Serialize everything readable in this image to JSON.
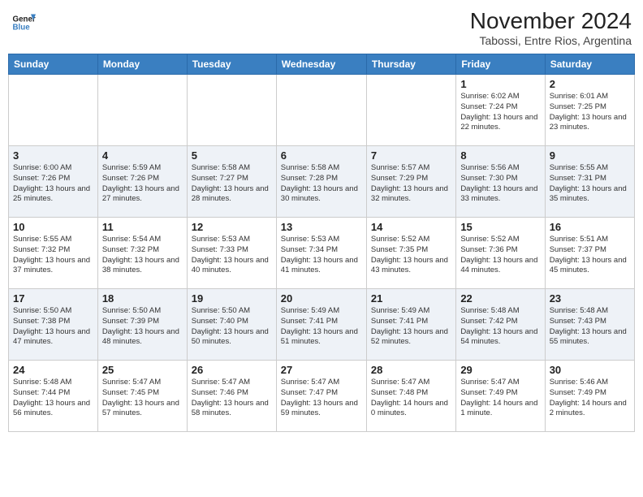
{
  "header": {
    "logo_line1": "General",
    "logo_line2": "Blue",
    "title": "November 2024",
    "subtitle": "Tabossi, Entre Rios, Argentina"
  },
  "days_of_week": [
    "Sunday",
    "Monday",
    "Tuesday",
    "Wednesday",
    "Thursday",
    "Friday",
    "Saturday"
  ],
  "weeks": [
    [
      {
        "day": "",
        "info": ""
      },
      {
        "day": "",
        "info": ""
      },
      {
        "day": "",
        "info": ""
      },
      {
        "day": "",
        "info": ""
      },
      {
        "day": "",
        "info": ""
      },
      {
        "day": "1",
        "info": "Sunrise: 6:02 AM\nSunset: 7:24 PM\nDaylight: 13 hours\nand 22 minutes."
      },
      {
        "day": "2",
        "info": "Sunrise: 6:01 AM\nSunset: 7:25 PM\nDaylight: 13 hours\nand 23 minutes."
      }
    ],
    [
      {
        "day": "3",
        "info": "Sunrise: 6:00 AM\nSunset: 7:26 PM\nDaylight: 13 hours\nand 25 minutes."
      },
      {
        "day": "4",
        "info": "Sunrise: 5:59 AM\nSunset: 7:26 PM\nDaylight: 13 hours\nand 27 minutes."
      },
      {
        "day": "5",
        "info": "Sunrise: 5:58 AM\nSunset: 7:27 PM\nDaylight: 13 hours\nand 28 minutes."
      },
      {
        "day": "6",
        "info": "Sunrise: 5:58 AM\nSunset: 7:28 PM\nDaylight: 13 hours\nand 30 minutes."
      },
      {
        "day": "7",
        "info": "Sunrise: 5:57 AM\nSunset: 7:29 PM\nDaylight: 13 hours\nand 32 minutes."
      },
      {
        "day": "8",
        "info": "Sunrise: 5:56 AM\nSunset: 7:30 PM\nDaylight: 13 hours\nand 33 minutes."
      },
      {
        "day": "9",
        "info": "Sunrise: 5:55 AM\nSunset: 7:31 PM\nDaylight: 13 hours\nand 35 minutes."
      }
    ],
    [
      {
        "day": "10",
        "info": "Sunrise: 5:55 AM\nSunset: 7:32 PM\nDaylight: 13 hours\nand 37 minutes."
      },
      {
        "day": "11",
        "info": "Sunrise: 5:54 AM\nSunset: 7:32 PM\nDaylight: 13 hours\nand 38 minutes."
      },
      {
        "day": "12",
        "info": "Sunrise: 5:53 AM\nSunset: 7:33 PM\nDaylight: 13 hours\nand 40 minutes."
      },
      {
        "day": "13",
        "info": "Sunrise: 5:53 AM\nSunset: 7:34 PM\nDaylight: 13 hours\nand 41 minutes."
      },
      {
        "day": "14",
        "info": "Sunrise: 5:52 AM\nSunset: 7:35 PM\nDaylight: 13 hours\nand 43 minutes."
      },
      {
        "day": "15",
        "info": "Sunrise: 5:52 AM\nSunset: 7:36 PM\nDaylight: 13 hours\nand 44 minutes."
      },
      {
        "day": "16",
        "info": "Sunrise: 5:51 AM\nSunset: 7:37 PM\nDaylight: 13 hours\nand 45 minutes."
      }
    ],
    [
      {
        "day": "17",
        "info": "Sunrise: 5:50 AM\nSunset: 7:38 PM\nDaylight: 13 hours\nand 47 minutes."
      },
      {
        "day": "18",
        "info": "Sunrise: 5:50 AM\nSunset: 7:39 PM\nDaylight: 13 hours\nand 48 minutes."
      },
      {
        "day": "19",
        "info": "Sunrise: 5:50 AM\nSunset: 7:40 PM\nDaylight: 13 hours\nand 50 minutes."
      },
      {
        "day": "20",
        "info": "Sunrise: 5:49 AM\nSunset: 7:41 PM\nDaylight: 13 hours\nand 51 minutes."
      },
      {
        "day": "21",
        "info": "Sunrise: 5:49 AM\nSunset: 7:41 PM\nDaylight: 13 hours\nand 52 minutes."
      },
      {
        "day": "22",
        "info": "Sunrise: 5:48 AM\nSunset: 7:42 PM\nDaylight: 13 hours\nand 54 minutes."
      },
      {
        "day": "23",
        "info": "Sunrise: 5:48 AM\nSunset: 7:43 PM\nDaylight: 13 hours\nand 55 minutes."
      }
    ],
    [
      {
        "day": "24",
        "info": "Sunrise: 5:48 AM\nSunset: 7:44 PM\nDaylight: 13 hours\nand 56 minutes."
      },
      {
        "day": "25",
        "info": "Sunrise: 5:47 AM\nSunset: 7:45 PM\nDaylight: 13 hours\nand 57 minutes."
      },
      {
        "day": "26",
        "info": "Sunrise: 5:47 AM\nSunset: 7:46 PM\nDaylight: 13 hours\nand 58 minutes."
      },
      {
        "day": "27",
        "info": "Sunrise: 5:47 AM\nSunset: 7:47 PM\nDaylight: 13 hours\nand 59 minutes."
      },
      {
        "day": "28",
        "info": "Sunrise: 5:47 AM\nSunset: 7:48 PM\nDaylight: 14 hours\nand 0 minutes."
      },
      {
        "day": "29",
        "info": "Sunrise: 5:47 AM\nSunset: 7:49 PM\nDaylight: 14 hours\nand 1 minute."
      },
      {
        "day": "30",
        "info": "Sunrise: 5:46 AM\nSunset: 7:49 PM\nDaylight: 14 hours\nand 2 minutes."
      }
    ]
  ]
}
